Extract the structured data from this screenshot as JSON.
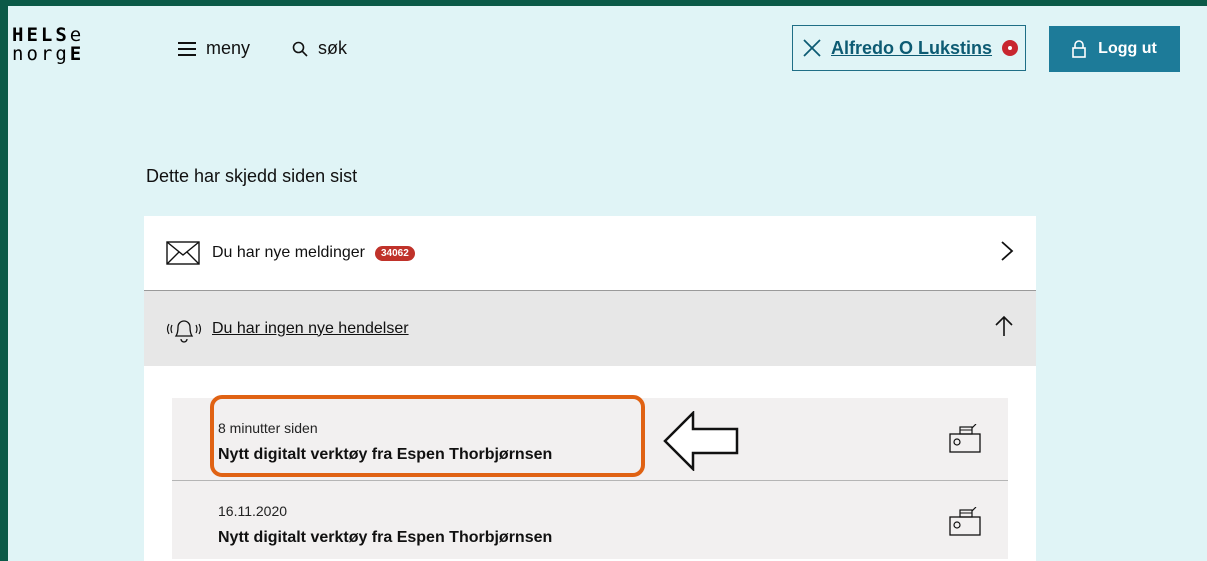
{
  "header": {
    "logo_line1": "HELSe",
    "logo_line2": "norgE",
    "menu_label": "meny",
    "search_label": "søk",
    "user_name": "Alfredo O Lukstins",
    "logout_label": "Logg ut"
  },
  "main": {
    "section_title": "Dette har skjedd siden sist",
    "messages_label": "Du har nye meldinger",
    "messages_count": "34062",
    "events_label": "Du har ingen nye hendelser",
    "events": [
      {
        "time": "8 minutter siden",
        "title": "Nytt digitalt verktøy fra Espen Thorbjørnsen"
      },
      {
        "time": "16.11.2020",
        "title": "Nytt digitalt verktøy fra Espen Thorbjørnsen"
      }
    ]
  },
  "colors": {
    "frame": "#0b5a48",
    "background": "#e0f4f6",
    "accent": "#1d7b99",
    "badge": "#c0322a",
    "highlight": "#e06213"
  },
  "icons": [
    "menu-icon",
    "search-icon",
    "close-icon",
    "notification-dot-icon",
    "lock-icon",
    "envelope-icon",
    "chevron-right-icon",
    "bell-icon",
    "arrow-up-icon",
    "mailbox-icon",
    "left-arrow-annotation-icon"
  ]
}
